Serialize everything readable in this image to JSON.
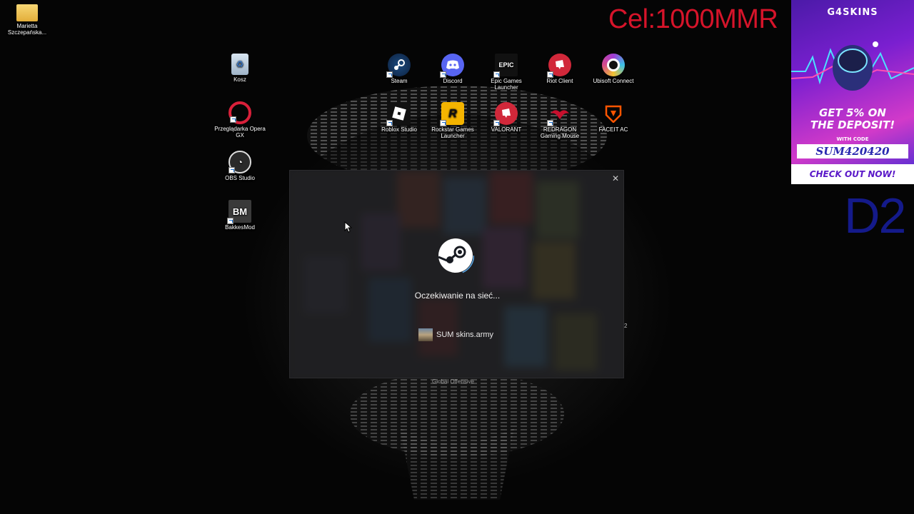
{
  "overlay": {
    "goal_text": "Cel:1000MMR",
    "side_text": "D2",
    "goal_color": "#d6142a",
    "side_color": "#141a8a"
  },
  "desktop_icons": [
    {
      "label": "Marietta Szczepańska...",
      "icon": "folder-icon"
    },
    {
      "label": "Kosz",
      "icon": "recycle-bin-icon"
    },
    {
      "label": "Przeglądarka Opera GX",
      "icon": "opera-gx-icon"
    },
    {
      "label": "OBS Studio",
      "icon": "obs-icon"
    },
    {
      "label": "BakkesMod",
      "icon": "bakkesmod-icon"
    },
    {
      "label": "Steam",
      "icon": "steam-icon"
    },
    {
      "label": "Discord",
      "icon": "discord-icon"
    },
    {
      "label": "Epic Games Launcher",
      "icon": "epic-games-icon"
    },
    {
      "label": "Riot Client",
      "icon": "riot-client-icon"
    },
    {
      "label": "Ubisoft Connect",
      "icon": "ubisoft-icon"
    },
    {
      "label": "Roblox Studio",
      "icon": "roblox-studio-icon"
    },
    {
      "label": "Rockstar Games Launcher",
      "icon": "rockstar-icon"
    },
    {
      "label": "VALORANT",
      "icon": "valorant-icon"
    },
    {
      "label": "REDRAGON Gaming Mouse",
      "icon": "redragon-icon"
    },
    {
      "label": "FACEIT AC",
      "icon": "faceit-icon"
    }
  ],
  "ad": {
    "brand": "G4SKINS",
    "headline_line1": "GET 5% ON",
    "headline_line2": "THE DEPOSIT!",
    "with_code": "WITH CODE",
    "code": "SUM420420",
    "cta": "CHECK OUT NOW!"
  },
  "steam_dialog": {
    "status": "Oczekiwanie na sieć...",
    "account_name": "SUM skins.army",
    "close_glyph": "✕"
  },
  "below_dialog_label": "Global Offensive",
  "stray_text": "2"
}
